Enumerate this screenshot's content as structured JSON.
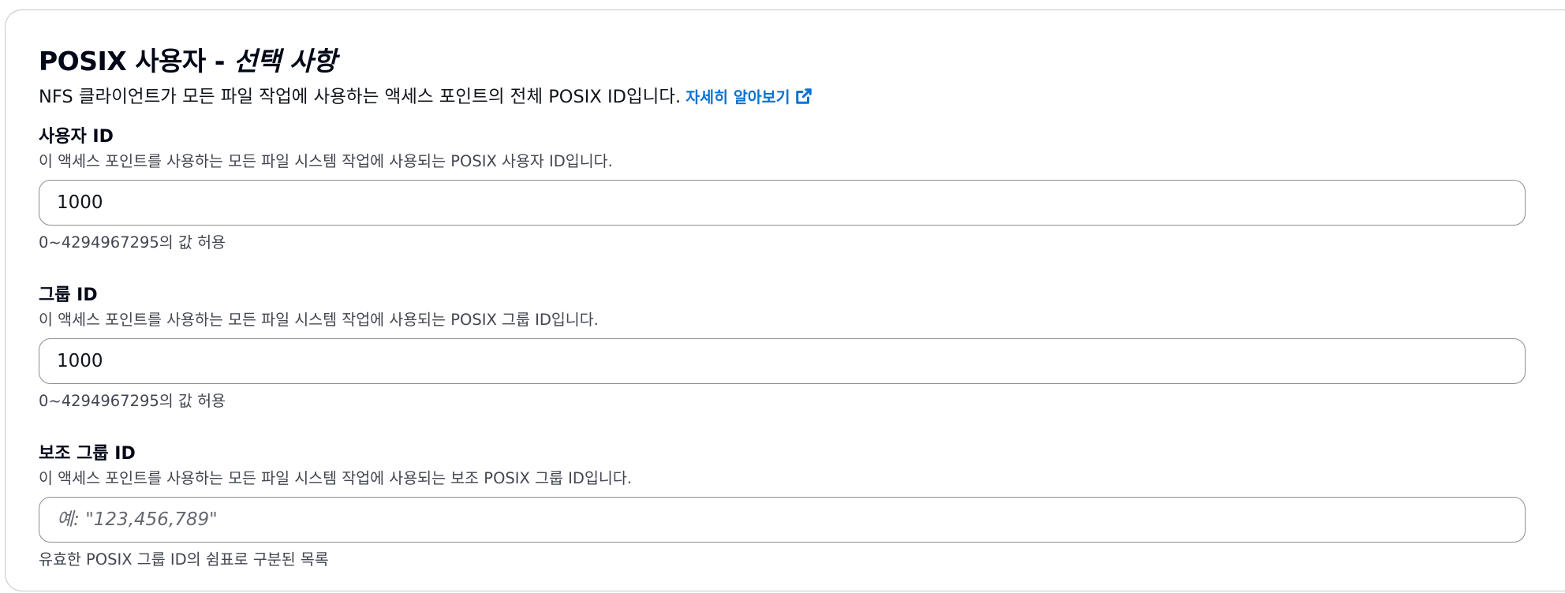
{
  "section": {
    "title": "POSIX 사용자 - ",
    "title_optional": "선택 사항",
    "description": "NFS 클라이언트가 모든 파일 작업에 사용하는 액세스 포인트의 전체 POSIX ID입니다.",
    "learn_more": "자세히 알아보기",
    "learn_more_icon": "external-link-icon",
    "link_color": "#0972d3"
  },
  "user_id": {
    "label": "사용자 ID",
    "description": "이 액세스 포인트를 사용하는 모든 파일 시스템 작업에 사용되는 POSIX 사용자 ID입니다.",
    "value": "1000",
    "constraint": "0~4294967295의 값 허용"
  },
  "group_id": {
    "label": "그룹 ID",
    "description": "이 액세스 포인트를 사용하는 모든 파일 시스템 작업에 사용되는 POSIX 그룹 ID입니다.",
    "value": "1000",
    "constraint": "0~4294967295의 값 허용"
  },
  "secondary_group_ids": {
    "label": "보조 그룹 ID",
    "description": "이 액세스 포인트를 사용하는 모든 파일 시스템 작업에 사용되는 보조 POSIX 그룹 ID입니다.",
    "value": "",
    "placeholder": "예: \"123,456,789\"",
    "constraint": "유효한 POSIX 그룹 ID의 쉼표로 구분된 목록"
  }
}
